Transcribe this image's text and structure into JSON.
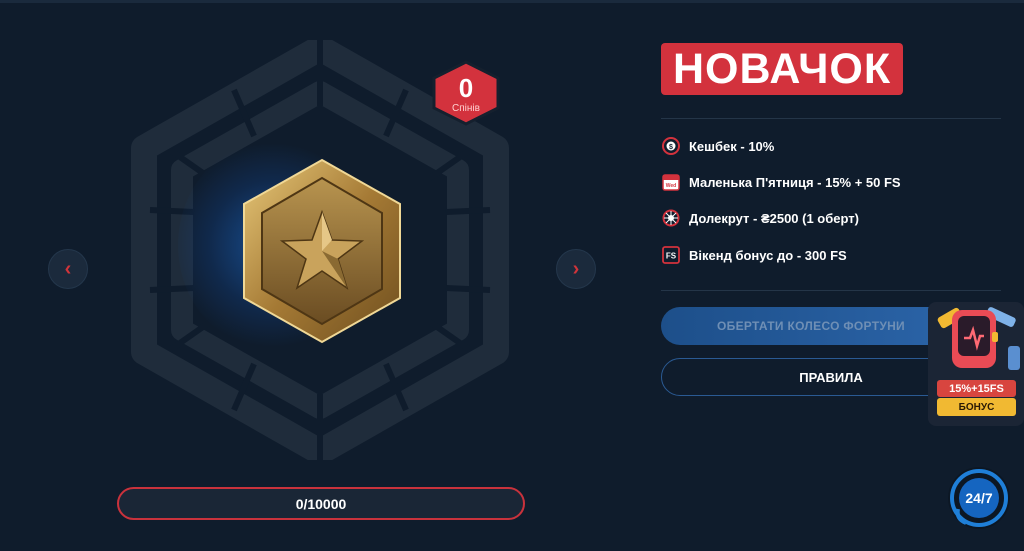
{
  "level": {
    "title": "НОВАЧОК",
    "spins_count": "0",
    "spins_label": "Спінів",
    "progress": "0/10000"
  },
  "perks": [
    {
      "icon": "cashback-icon",
      "label": "Кешбек - 10%"
    },
    {
      "icon": "calendar-icon",
      "label": "Маленька П'ятниця - 15% + 50 FS"
    },
    {
      "icon": "wheel-icon",
      "label": "Долекрут - ₴2500 (1 оберт)"
    },
    {
      "icon": "fs-icon",
      "label": "Вікенд бонус до - 300 FS"
    }
  ],
  "calendar_day": "Wed",
  "fs_badge": "FS",
  "buttons": {
    "spin_wheel": "ОБЕРТАТИ КОЛЕСО ФОРТУНИ",
    "rules": "ПРАВИЛА",
    "prev": "‹",
    "next": "›"
  },
  "promo": {
    "percent": "15%+15FS",
    "label": "БОНУС"
  },
  "support": {
    "label": "24/7"
  },
  "colors": {
    "background": "#0f1c2c",
    "accent_red": "#d3323d",
    "accent_blue": "#2b64a8",
    "bonus_yellow": "#f1b932"
  }
}
